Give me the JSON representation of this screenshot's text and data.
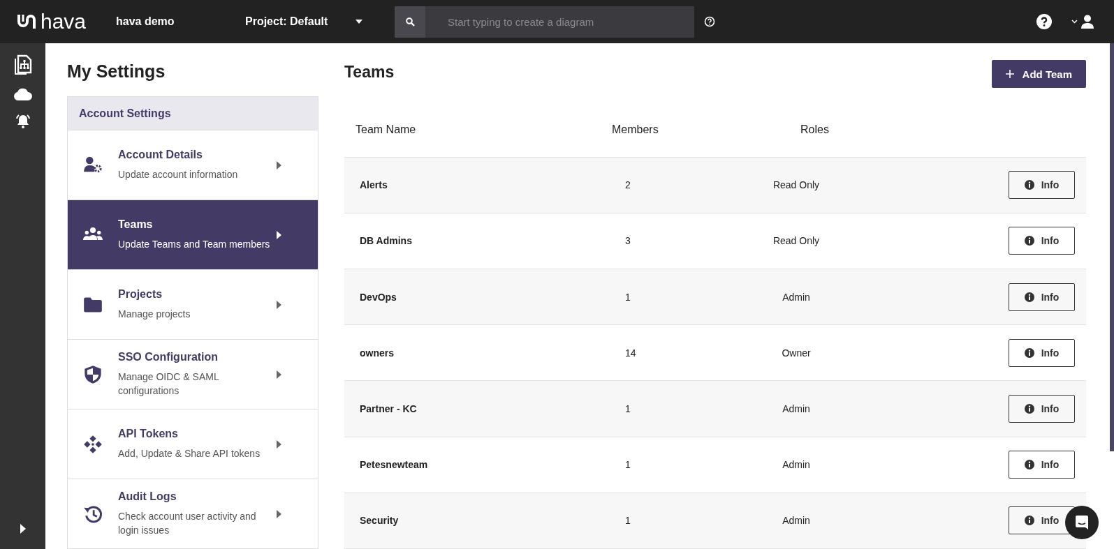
{
  "topbar": {
    "brand": "hava",
    "account": "hava demo",
    "project": "Project: Default",
    "search": {
      "placeholder": "Start typing to create a diagram"
    }
  },
  "page_title": "My Settings",
  "settings": {
    "header": "Account Settings",
    "items": [
      {
        "kind": "account",
        "title": "Account Details",
        "subtitle": "Update account information",
        "selected": false
      },
      {
        "kind": "teams",
        "title": "Teams",
        "subtitle": "Update Teams and Team members",
        "selected": true
      },
      {
        "kind": "projects",
        "title": "Projects",
        "subtitle": "Manage projects",
        "selected": false
      },
      {
        "kind": "sso",
        "title": "SSO Configuration",
        "subtitle": "Manage OIDC & SAML configurations",
        "selected": false
      },
      {
        "kind": "api",
        "title": "API Tokens",
        "subtitle": "Add, Update & Share API tokens",
        "selected": false
      },
      {
        "kind": "audit",
        "title": "Audit Logs",
        "subtitle": "Check account user activity and login issues",
        "selected": false
      }
    ]
  },
  "teams": {
    "title": "Teams",
    "add_button": "Add Team",
    "columns": [
      "Team Name",
      "Members",
      "Roles"
    ],
    "rows": [
      {
        "name": "Alerts",
        "members": "2",
        "role": "Read Only",
        "action": "Info"
      },
      {
        "name": "DB Admins",
        "members": "3",
        "role": "Read Only",
        "action": "Info"
      },
      {
        "name": "DevOps",
        "members": "1",
        "role": "Admin",
        "action": "Info"
      },
      {
        "name": "owners",
        "members": "14",
        "role": "Owner",
        "action": "Info"
      },
      {
        "name": "Partner - KC",
        "members": "1",
        "role": "Admin",
        "action": "Info"
      },
      {
        "name": "Petesnewteam",
        "members": "1",
        "role": "Admin",
        "action": "Info"
      },
      {
        "name": "Security",
        "members": "1",
        "role": "Admin",
        "action": "Info"
      }
    ]
  }
}
